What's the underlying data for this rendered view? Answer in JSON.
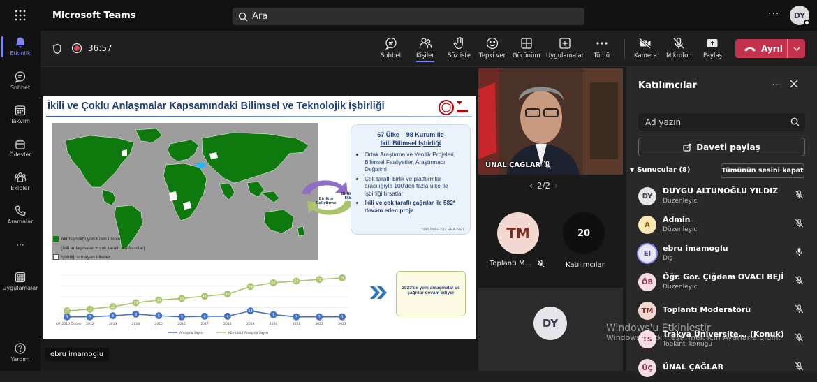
{
  "app": {
    "title": "Microsoft Teams",
    "search_placeholder": "Ara",
    "user_initials": "DY",
    "more": "···"
  },
  "rail": [
    {
      "label": "Etkinlik",
      "icon": "bell-icon"
    },
    {
      "label": "Sohbet",
      "icon": "chat-icon"
    },
    {
      "label": "Takvim",
      "icon": "calendar-icon"
    },
    {
      "label": "Ödevler",
      "icon": "assignments-icon"
    },
    {
      "label": "Ekipler",
      "icon": "teams-icon"
    },
    {
      "label": "Aramalar",
      "icon": "phone-icon"
    },
    {
      "label": "···",
      "icon": "more-icon"
    },
    {
      "label": "Uygulamalar",
      "icon": "apps-icon"
    },
    {
      "label": "Yardım",
      "icon": "help-icon"
    }
  ],
  "meeting": {
    "timer": "36:57",
    "toolbar": {
      "chat": "Sohbet",
      "people": "Kişiler",
      "raise": "Söz iste",
      "react": "Tepki ver",
      "view": "Görünüm",
      "apps": "Uygulamalar",
      "more": "Tümü",
      "camera": "Kamera",
      "mic": "Mikrofon",
      "share": "Paylaş"
    },
    "leave_label": "Ayrıl"
  },
  "slide": {
    "title": "İkili ve Çoklu Anlaşmalar Kapsamındaki Bilimsel ve Teknolojik İşbirliği",
    "logo_text": "TÜBİTAK",
    "legend_green_1": "Aktif işbirliği yürütülen ülkeler",
    "legend_green_2": "(İkili anlaşmalar + çok taraflı platformlar)",
    "legend_white": "İşbirliği olmayan ülkeler",
    "arrow_left": "Birlikte Geliştirme",
    "arrow_right": "Birlikte Etki",
    "box_heading_1": "67 Ülke – 98 Kurum ile",
    "box_heading_2": "İkili Bilimsel İşbirliği",
    "bullets": [
      "Ortak Araştırma ve Yenilik Projeleri, Bilimsel Faaliyetler, Araştırmacı Değişimi",
      "Çok taraflı birlik ve platformlar aracılığıyla 100'den fazla ülke ile işbirliği fırsatları",
      "İkili ve çok taraflı çağrılar ile 582* devam eden proje"
    ],
    "box_note": "*345 İkili + 237 ERA-NET",
    "note_box": "2023'de yeni anlaşmalar ve çağrılar devam ediyor",
    "presenter": "ebru imamoglu"
  },
  "chart_data": {
    "type": "line",
    "categories": [
      "2007-2010 Öncesi",
      "2012",
      "2013",
      "2014",
      "2015",
      "2016",
      "2017",
      "2018",
      "2019",
      "2020",
      "2021",
      "2022",
      "2023"
    ],
    "series": [
      {
        "name": "Anlaşma Sayısı",
        "values": [
          3,
          3,
          5,
          8,
          5,
          3,
          4,
          4,
          14,
          7,
          3,
          3,
          3
        ],
        "color": "#4472c4"
      },
      {
        "name": "Kümülatif Anlaşma Sayısı",
        "values": [
          14,
          17,
          22,
          29,
          34,
          37,
          41,
          45,
          59,
          66,
          69,
          72,
          75
        ],
        "color": "#a9c46b"
      }
    ],
    "data_labels_1": [
      "3",
      "3",
      "5",
      "8",
      "5",
      "3",
      "4",
      "4",
      "14",
      "7",
      "3",
      "3",
      "3"
    ],
    "data_labels_2": [
      "14",
      "17",
      "22",
      "29",
      "34",
      "37",
      "41",
      "45",
      "59",
      "66",
      "69",
      "72",
      "75"
    ],
    "ylim": [
      0,
      80
    ]
  },
  "tiles": {
    "video_name": "ÜNAL ÇAĞLAR",
    "pager": "2/2",
    "tm_initials": "TM",
    "tm_label": "Toplantı M...",
    "count": "20",
    "count_label": "Katılımcılar",
    "dy_initials": "DY"
  },
  "panel": {
    "title": "Katılımcılar",
    "more": "···",
    "search_placeholder": "Ad yazın",
    "invite": "Daveti paylaş",
    "presenters": "Sunucular (8)",
    "mute_all": "Tümünün sesini kapat",
    "participants": [
      {
        "initials": "DY",
        "name": "DUYGU ALTUNOĞLU YILDIZ",
        "role": "Düzenleyici",
        "color": "#e6e6ea",
        "fg": "#3b3b4e",
        "mic": "muted"
      },
      {
        "initials": "A",
        "name": "Admin",
        "role": "Düzenleyici",
        "color": "#fbe7b5",
        "fg": "#8a5a00",
        "mic": "muted"
      },
      {
        "initials": "EI",
        "name": "ebru imamoglu",
        "role": "Dış",
        "color": "#e8e6f5",
        "fg": "#4f4a8a",
        "mic": "on"
      },
      {
        "initials": "ÖB",
        "name": "Öğr. Gör. Çiğdem OVACI BEJİ",
        "role": "Düzenleyici",
        "color": "#f6dde5",
        "fg": "#8a3453",
        "mic": "muted"
      },
      {
        "initials": "TM",
        "name": "Toplantı Moderatörü",
        "role": "",
        "color": "#f3d8d2",
        "fg": "#7a2e22",
        "mic": "muted"
      },
      {
        "initials": "TS",
        "name": "Trakya Üniversite... (Konuk)",
        "role": "Toplantı konuğu",
        "color": "#f6dde5",
        "fg": "#8a3453",
        "mic": "muted"
      },
      {
        "initials": "ÜÇ",
        "name": "ÜNAL ÇAĞLAR",
        "role": "",
        "color": "#f6dde5",
        "fg": "#8a3453",
        "mic": "muted"
      }
    ]
  },
  "watermark": {
    "line1": "Windows'u Etkinleştir",
    "line2": "Windows'u etkinleştirmek için Ayarlar'a gidin."
  }
}
